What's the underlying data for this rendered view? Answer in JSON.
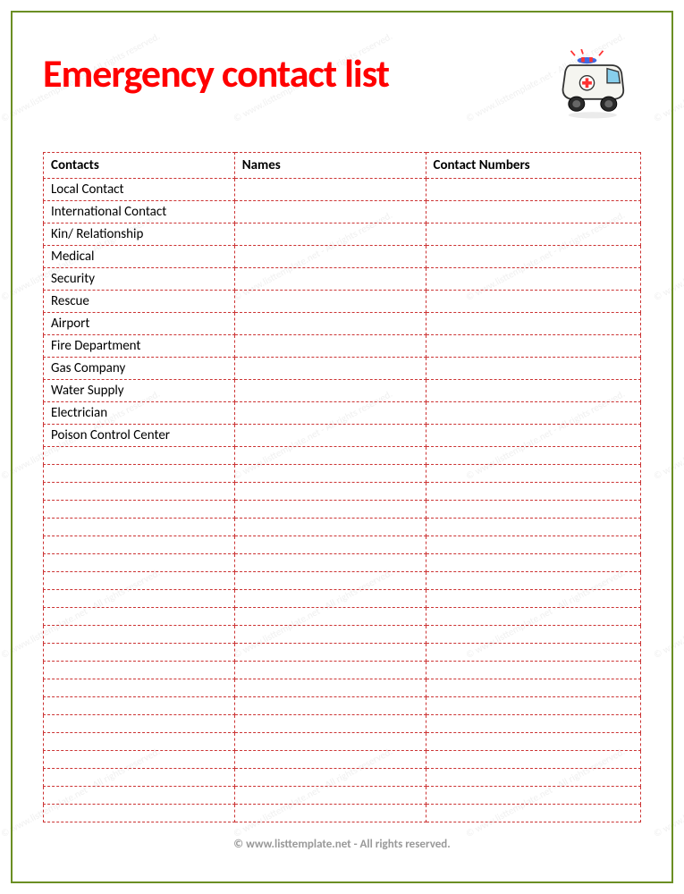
{
  "title": "Emergency contact list",
  "columns": {
    "contacts": "Contacts",
    "names": "Names",
    "numbers": "Contact Numbers"
  },
  "rows": [
    {
      "contact": "Local Contact",
      "name": "",
      "number": ""
    },
    {
      "contact": "International Contact",
      "name": "",
      "number": ""
    },
    {
      "contact": "Kin/ Relationship",
      "name": "",
      "number": ""
    },
    {
      "contact": "Medical",
      "name": "",
      "number": ""
    },
    {
      "contact": "Security",
      "name": "",
      "number": ""
    },
    {
      "contact": "Rescue",
      "name": "",
      "number": ""
    },
    {
      "contact": "Airport",
      "name": "",
      "number": ""
    },
    {
      "contact": "Fire Department",
      "name": "",
      "number": ""
    },
    {
      "contact": "Gas Company",
      "name": "",
      "number": ""
    },
    {
      "contact": "Water Supply",
      "name": "",
      "number": ""
    },
    {
      "contact": "Electrician",
      "name": "",
      "number": ""
    },
    {
      "contact": "Poison Control Center",
      "name": "",
      "number": ""
    }
  ],
  "empty_rows": 21,
  "footer": "© www.listtemplate.net - All rights reserved.",
  "watermark": "© www.listtemplate.net - All rights reserved."
}
